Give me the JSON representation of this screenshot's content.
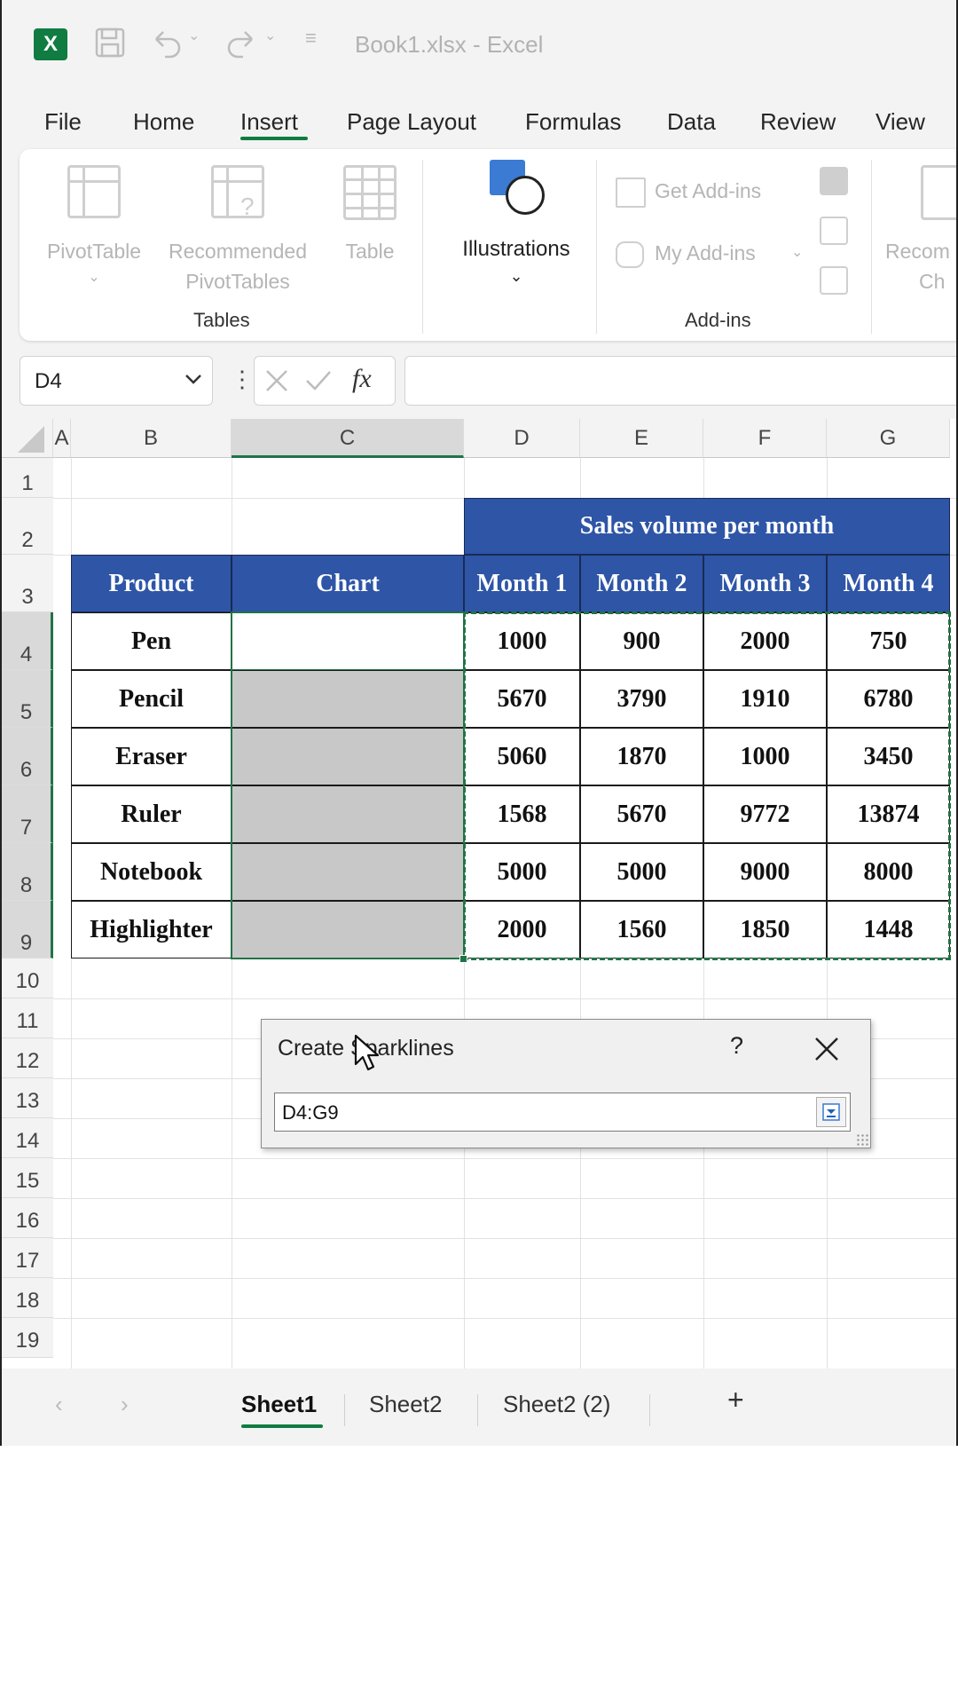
{
  "titlebar": {
    "doc_title": "Book1.xlsx  -  Excel",
    "logo": "X"
  },
  "menu": {
    "file": "File",
    "home": "Home",
    "insert": "Insert",
    "page_layout": "Page Layout",
    "formulas": "Formulas",
    "data": "Data",
    "review": "Review",
    "view": "View"
  },
  "ribbon": {
    "pivottable": "PivotTable",
    "recommended_line1": "Recommended",
    "recommended_line2": "PivotTables",
    "table": "Table",
    "illustrations": "Illustrations",
    "get_addins": "Get Add-ins",
    "my_addins": "My Add-ins",
    "recom_partial1": "Recom",
    "recom_partial2": "Ch",
    "group_tables": "Tables",
    "group_addins": "Add-ins"
  },
  "formula_bar": {
    "name_box": "D4",
    "fx": "fx",
    "formula": ""
  },
  "columns": [
    "A",
    "B",
    "C",
    "D",
    "E",
    "F",
    "G"
  ],
  "rows": [
    "1",
    "2",
    "3",
    "4",
    "5",
    "6",
    "7",
    "8",
    "9",
    "10",
    "11",
    "12",
    "13",
    "14",
    "15",
    "16",
    "17",
    "18",
    "19"
  ],
  "table": {
    "title": "Sales volume per month",
    "headers": [
      "Product",
      "Chart",
      "Month 1",
      "Month 2",
      "Month 3",
      "Month 4"
    ],
    "data": [
      [
        "Pen",
        "1000",
        "900",
        "2000",
        "750"
      ],
      [
        "Pencil",
        "5670",
        "3790",
        "1910",
        "6780"
      ],
      [
        "Eraser",
        "5060",
        "1870",
        "1000",
        "3450"
      ],
      [
        "Ruler",
        "1568",
        "5670",
        "9772",
        "13874"
      ],
      [
        "Notebook",
        "5000",
        "5000",
        "9000",
        "8000"
      ],
      [
        "Highlighter",
        "2000",
        "1560",
        "1850",
        "1448"
      ]
    ]
  },
  "sheets": {
    "tabs": [
      "Sheet1",
      "Sheet2",
      "Sheet2 (2)"
    ],
    "active": "Sheet1"
  },
  "dialog": {
    "title": "Create Sparklines",
    "help": "?",
    "range_value": "D4:G9"
  },
  "colors": {
    "header_blue": "#2e55a6",
    "excel_green": "#107c41",
    "selection_green": "#217346"
  }
}
